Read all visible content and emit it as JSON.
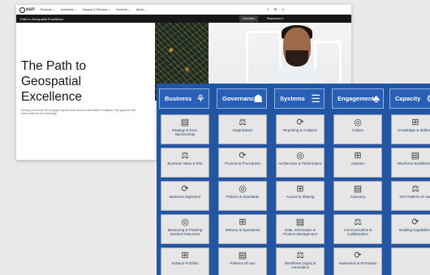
{
  "topnav": {
    "logo": "esri",
    "items": [
      "Products ⌄",
      "Industries ⌄",
      "Support & Services ⌄",
      "Partners ⌄",
      "About ⌄"
    ],
    "icons": [
      "search-icon",
      "globe-icon",
      "user-icon"
    ]
  },
  "subnav": {
    "title": "Path to Geospatial Excellence",
    "tabs": [
      "Overview",
      "Resources ▾"
    ]
  },
  "hero": {
    "title": "The Path to Geospatial Excellence",
    "description": "Running a full-scale GIS program requires skills across a wide swath of subjects. Find guidance from those closest to the technology."
  },
  "matrix": {
    "headers": [
      {
        "label": "Business",
        "icon": "network-icon"
      },
      {
        "label": "Governance",
        "icon": "people-icon"
      },
      {
        "label": "Systems",
        "icon": "server-icon"
      },
      {
        "label": "Engagement",
        "icon": "community-icon"
      },
      {
        "label": "Capacity",
        "icon": "gear-icon"
      }
    ],
    "columns": [
      [
        "Strategy & Exec. Sponsorship",
        "Business Value & ROI",
        "Business Alignment",
        "Measuring & Tracking Desired Outcomes",
        "Solution Portfolio"
      ],
      [
        "Organization",
        "Process & Procedures",
        "Policies & Standards",
        "Delivery & Operations",
        "Patterns Of Use"
      ],
      [
        "Reporting & Analytics",
        "Architecture & Performance",
        "Access & Sharing",
        "Data, Information & Product Management",
        "Workflows (Apps) & Automation"
      ],
      [
        "Culture",
        "Adoption",
        "Advocacy",
        "Communication & Collaboration",
        "Awareness & Promotion"
      ],
      [
        "Knowledge & Skillsets",
        "Workforce Enablement",
        "GIS Patterns of Use",
        "Building Capabilities",
        ""
      ]
    ]
  }
}
